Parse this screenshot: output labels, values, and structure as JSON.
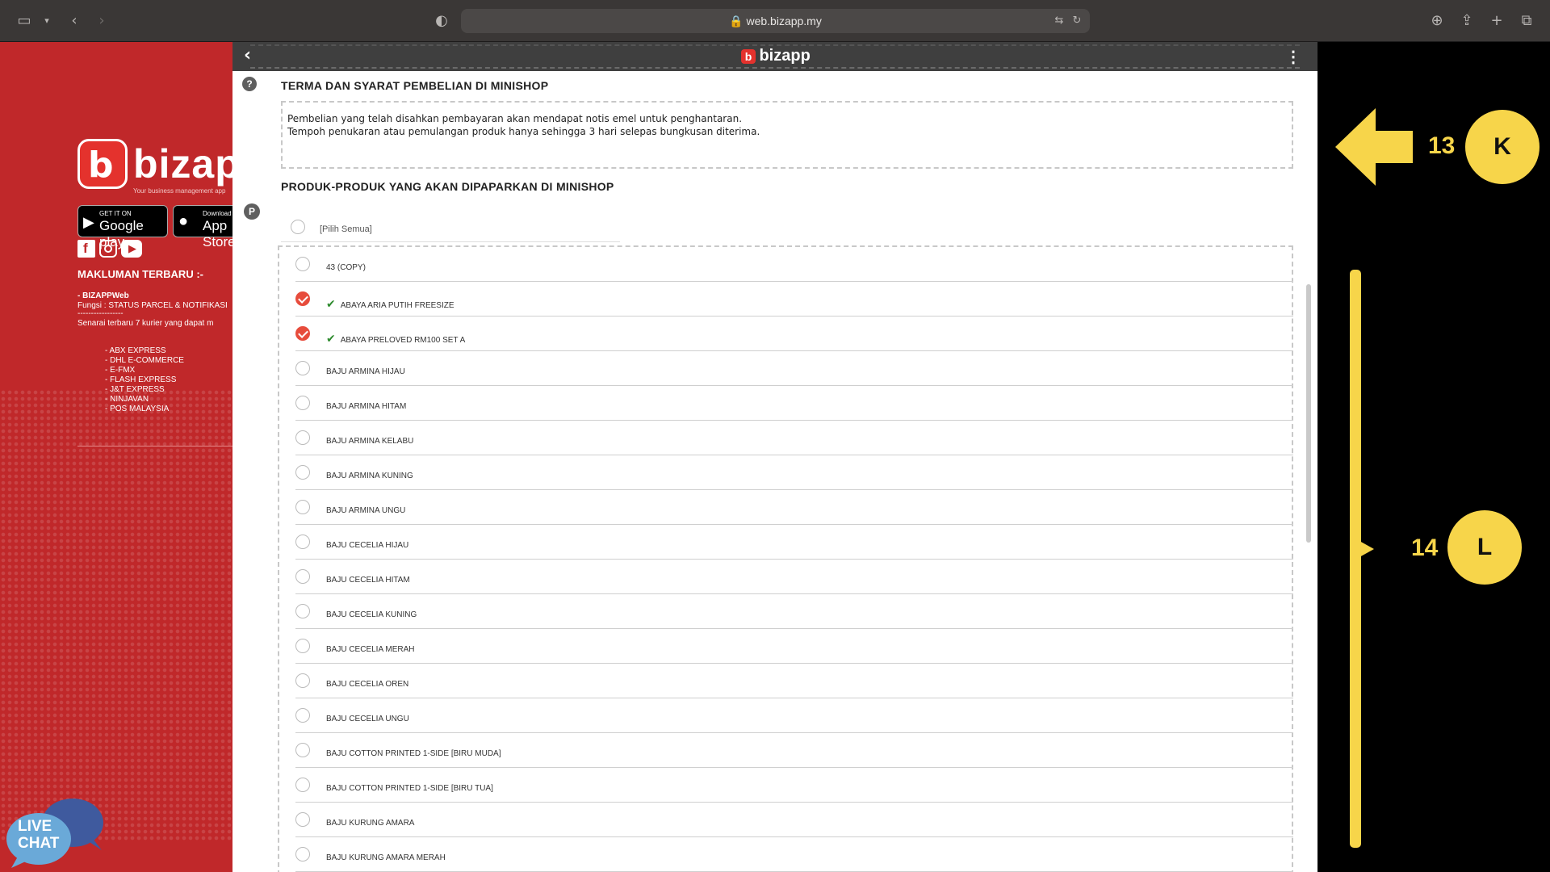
{
  "browser": {
    "url": "web.bizapp.my"
  },
  "left_panel": {
    "logo_text": "bizapp",
    "logo_tagline": "Your business management app",
    "google_play_small": "GET IT ON",
    "google_play_big": "Google play",
    "app_store_small": "Download on the",
    "app_store_big": "App Store",
    "news_title": "MAKLUMAN TERBARU :-",
    "news_lines": [
      "- BIZAPPWeb",
      "Fungsi : STATUS PARCEL & NOTIFIKASI",
      "-----------------",
      "Senarai terbaru 7 kurier yang dapat m"
    ],
    "couriers": [
      "- ABX EXPRESS",
      "- DHL E-COMMERCE",
      "- E-FMX",
      "- FLASH EXPRESS",
      "- J&T EXPRESS",
      "- NINJAVAN",
      "- POS MALAYSIA"
    ],
    "live_chat_line1": "LIVE",
    "live_chat_line2": "CHAT"
  },
  "main": {
    "topbar_logo": "bizapp",
    "terms_title": "TERMA DAN SYARAT PEMBELIAN DI MINISHOP",
    "terms_help_icon": "?",
    "terms_text": [
      "Pembelian yang telah disahkan pembayaran akan mendapat notis emel untuk penghantaran.",
      "Tempoh penukaran atau pemulangan produk hanya sehingga 3 hari selepas bungkusan diterima."
    ],
    "products_title": "PRODUK-PRODUK YANG AKAN DIPAPARKAN DI MINISHOP",
    "products_icon": "P",
    "select_all_label": "[Pilih Semua]",
    "products": [
      {
        "name": "43 (COPY)",
        "checked": false
      },
      {
        "name": "ABAYA ARIA PUTIH FREESIZE",
        "checked": true
      },
      {
        "name": "ABAYA PRELOVED RM100 SET A",
        "checked": true
      },
      {
        "name": "BAJU ARMINA HIJAU",
        "checked": false
      },
      {
        "name": "BAJU ARMINA HITAM",
        "checked": false
      },
      {
        "name": "BAJU ARMINA KELABU",
        "checked": false
      },
      {
        "name": "BAJU ARMINA KUNING",
        "checked": false
      },
      {
        "name": "BAJU ARMINA UNGU",
        "checked": false
      },
      {
        "name": "BAJU CECELIA HIJAU",
        "checked": false
      },
      {
        "name": "BAJU CECELIA HITAM",
        "checked": false
      },
      {
        "name": "BAJU CECELIA KUNING",
        "checked": false
      },
      {
        "name": "BAJU CECELIA MERAH",
        "checked": false
      },
      {
        "name": "BAJU CECELIA OREN",
        "checked": false
      },
      {
        "name": "BAJU CECELIA UNGU",
        "checked": false
      },
      {
        "name": "BAJU COTTON PRINTED 1-SIDE [BIRU MUDA]",
        "checked": false
      },
      {
        "name": "BAJU COTTON PRINTED 1-SIDE [BIRU TUA]",
        "checked": false
      },
      {
        "name": "BAJU KURUNG AMARA",
        "checked": false
      },
      {
        "name": "BAJU KURUNG AMARA MERAH",
        "checked": false
      }
    ]
  },
  "annotations": {
    "k_number": "13",
    "k_letter": "K",
    "l_number": "14",
    "l_letter": "L",
    "color": "#f7d54a"
  }
}
